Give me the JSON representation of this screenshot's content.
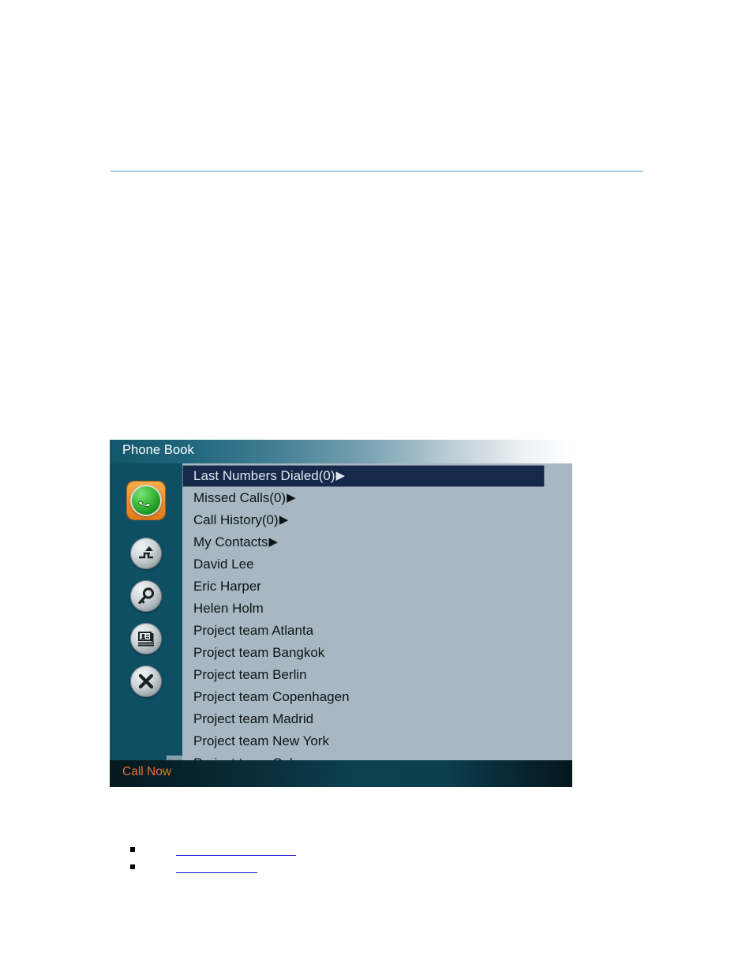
{
  "document": {
    "rule": "horizontal-rule"
  },
  "panel": {
    "title": "Phone Book",
    "footer_label": "Call Now",
    "colors": {
      "sidebar": "#0f4f63",
      "list_background": "#a8b7c2",
      "selected_row": "#17294a",
      "footer_accent": "#e8752a",
      "active_button": "#ef8b2c",
      "title_text": "#ffffff"
    },
    "sidebar_buttons": [
      {
        "icon": "phone-call-icon",
        "active": true
      },
      {
        "icon": "call-transfer-icon",
        "active": false
      },
      {
        "icon": "search-key-icon",
        "active": false
      },
      {
        "icon": "contact-card-icon",
        "active": false
      },
      {
        "icon": "end-call-icon",
        "active": false
      }
    ],
    "list": {
      "scroll_indicator": "scroll-down-arrow",
      "scroll_indicator_row_index": 12,
      "items": [
        {
          "label": "Last Numbers Dialed(0)",
          "caret": "▶",
          "selected": true
        },
        {
          "label": "Missed Calls(0)",
          "caret": "▶",
          "selected": false
        },
        {
          "label": "Call History(0)",
          "caret": "▶",
          "selected": false
        },
        {
          "label": "My Contacts",
          "caret": "▶",
          "selected": false
        },
        {
          "label": "David Lee",
          "caret": "",
          "selected": false
        },
        {
          "label": "Eric Harper",
          "caret": "",
          "selected": false
        },
        {
          "label": "Helen Holm",
          "caret": "",
          "selected": false
        },
        {
          "label": "Project team Atlanta",
          "caret": "",
          "selected": false
        },
        {
          "label": "Project team Bangkok",
          "caret": "",
          "selected": false
        },
        {
          "label": "Project team Berlin",
          "caret": "",
          "selected": false
        },
        {
          "label": "Project team Copenhagen",
          "caret": "",
          "selected": false
        },
        {
          "label": "Project team Madrid",
          "caret": "",
          "selected": false
        },
        {
          "label": "Project team New York",
          "caret": "",
          "selected": false
        },
        {
          "label": "Project team Oslo",
          "caret": "",
          "selected": false
        }
      ]
    }
  },
  "bullets": [
    {
      "marker": "square-bullet",
      "link_text": ""
    },
    {
      "marker": "square-bullet",
      "link_text": ""
    }
  ]
}
